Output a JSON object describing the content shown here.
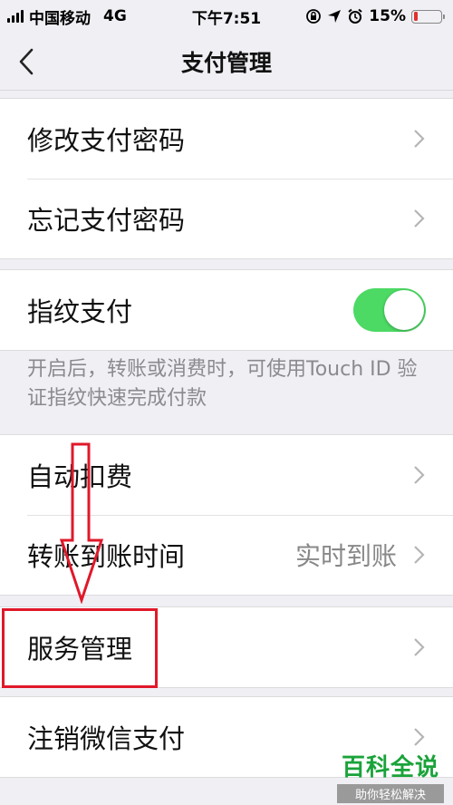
{
  "status_bar": {
    "carrier": "中国移动",
    "network": "4G",
    "time": "下午7:51",
    "battery_percent": "15%",
    "battery_level": 0.15
  },
  "nav": {
    "title": "支付管理"
  },
  "groups": {
    "password": {
      "change_label": "修改支付密码",
      "forgot_label": "忘记支付密码"
    },
    "fingerprint": {
      "label": "指纹支付",
      "enabled": true,
      "note": "开启后，转账或消费时，可使用Touch ID 验证指纹快速完成付款"
    },
    "auto": {
      "auto_deduct_label": "自动扣费",
      "transfer_time_label": "转账到账时间",
      "transfer_time_value": "实时到账"
    },
    "service": {
      "label": "服务管理"
    },
    "cancel": {
      "label": "注销微信支付"
    }
  },
  "watermark": {
    "title": "百科全说",
    "subtitle": "助你轻松解决"
  },
  "colors": {
    "toggle_on": "#4cd964",
    "annotation": "#e0182a",
    "watermark_green": "#1aa33a"
  }
}
